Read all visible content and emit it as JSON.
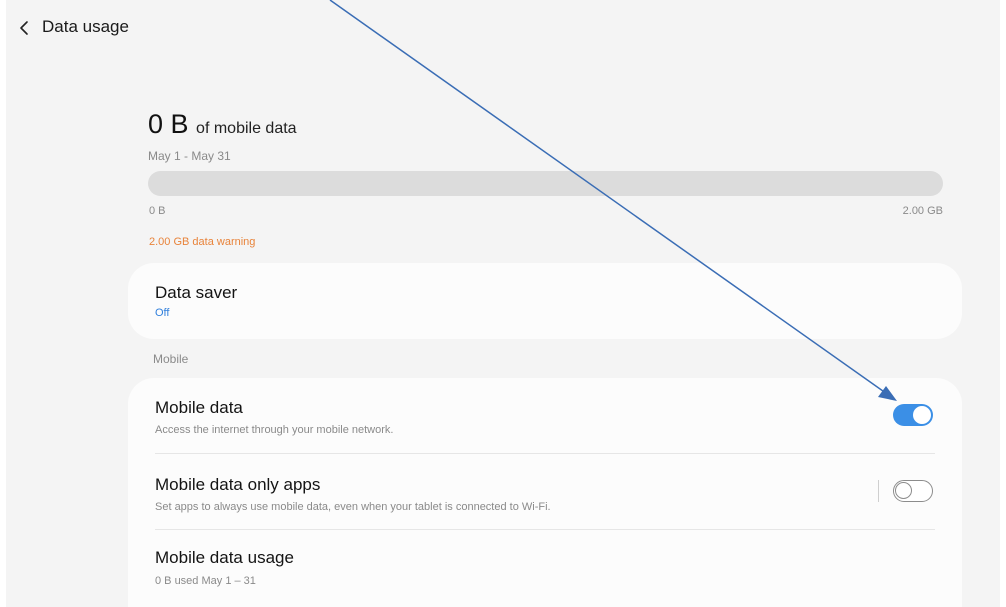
{
  "header": {
    "back_icon": "chevron-left-icon",
    "title": "Data usage"
  },
  "usage": {
    "amount": "0 B",
    "amount_suffix": "of mobile data",
    "period": "May 1 - May 31",
    "bar_fraction": 0,
    "bar_min_label": "0 B",
    "bar_max_label": "2.00 GB",
    "warning": "2.00 GB data warning"
  },
  "data_saver": {
    "title": "Data saver",
    "status": "Off"
  },
  "section": {
    "label": "Mobile"
  },
  "mobile_rows": [
    {
      "title": "Mobile data",
      "subtitle": "Access the internet through your mobile network.",
      "toggle": true
    },
    {
      "title": "Mobile data only apps",
      "subtitle": "Set apps to always use mobile data, even when your tablet is connected to Wi-Fi.",
      "toggle": false
    },
    {
      "title": "Mobile data usage",
      "subtitle": "0 B used May 1 – 31"
    }
  ],
  "colors": {
    "accent": "#3b8fe6",
    "warning": "#e8833a",
    "annotation_arrow": "#3a6db5"
  }
}
